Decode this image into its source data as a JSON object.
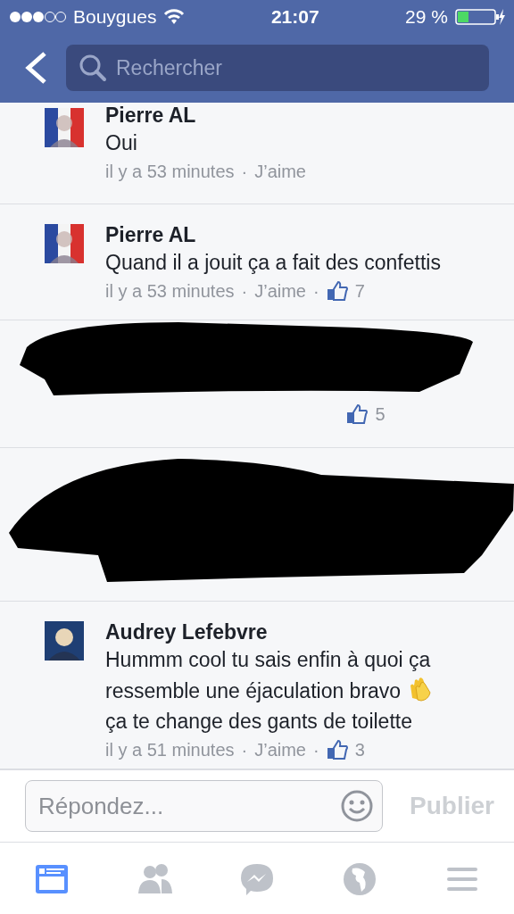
{
  "status_bar": {
    "carrier": "Bouygues",
    "time": "21:07",
    "battery": "29 %"
  },
  "search": {
    "placeholder": "Rechercher"
  },
  "comments": [
    {
      "kind": "comment",
      "author": "Pierre AL",
      "text": "Oui",
      "meta": [
        {
          "kind": "time",
          "text": "il y a 53 minutes"
        },
        {
          "kind": "sep",
          "text": "·"
        },
        {
          "kind": "like",
          "text": "J’aime"
        }
      ]
    },
    {
      "kind": "comment",
      "author": "Pierre AL",
      "text": "Quand il a jouit ça a fait des confettis",
      "meta": [
        {
          "kind": "time",
          "text": "il y a 53 minutes"
        },
        {
          "kind": "sep",
          "text": "·"
        },
        {
          "kind": "like",
          "text": "J’aime"
        },
        {
          "kind": "sep",
          "text": "·"
        },
        {
          "kind": "likes",
          "text": "7"
        }
      ]
    },
    {
      "kind": "redacted",
      "meta": [
        {
          "kind": "likes",
          "text": "5"
        }
      ]
    },
    {
      "kind": "redacted"
    },
    {
      "kind": "comment",
      "author": "Audrey Lefebvre",
      "text": "Hummm cool tu sais enfin à quoi ça ressemble une éjaculation bravo",
      "text_after": "ça te change des gants de toilette",
      "meta": [
        {
          "kind": "time",
          "text": "il y a 51 minutes"
        },
        {
          "kind": "sep",
          "text": "·"
        },
        {
          "kind": "like",
          "text": "J’aime"
        },
        {
          "kind": "sep",
          "text": "·"
        },
        {
          "kind": "likes",
          "text": "3"
        }
      ]
    }
  ],
  "reply": {
    "placeholder": "Répondez...",
    "button": "Publier",
    "disabled": true
  },
  "tabs": [
    {
      "selected": true
    },
    {
      "selected": false
    },
    {
      "selected": false
    },
    {
      "selected": false
    },
    {
      "selected": false
    }
  ]
}
